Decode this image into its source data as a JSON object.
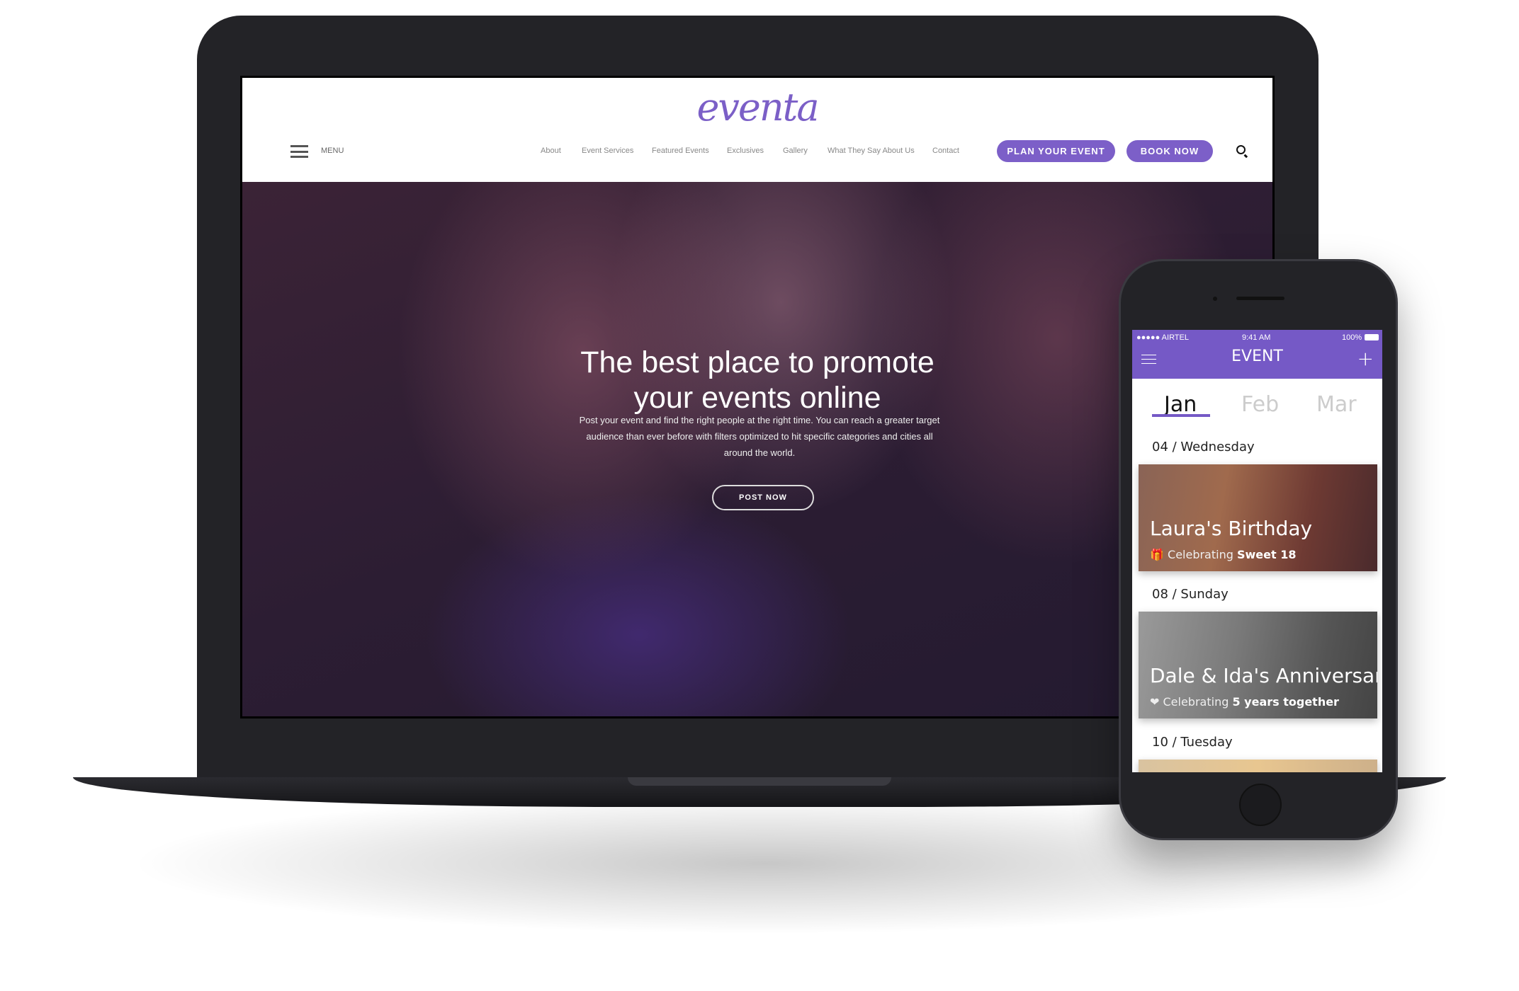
{
  "website": {
    "logo": "eventa",
    "menu_label": "MENU",
    "nav": [
      "About",
      "Event Services",
      "Featured Events",
      "Exclusives",
      "Gallery",
      "What They Say About Us",
      "Contact"
    ],
    "plan_button": "PLAN YOUR EVENT",
    "book_button": "BOOK NOW",
    "hero": {
      "title": "The best place to promote your events online",
      "text": "Post your event and find the right people at the right time. You can reach a greater target audience than ever before with filters optimized to hit specific categories and cities all around the world.",
      "button": "POST NOW"
    },
    "accent": "#7c5fc8"
  },
  "app": {
    "status": {
      "carrier": "●●●●● AIRTEL",
      "time": "9:41 AM",
      "battery": "100%"
    },
    "title": "EVENT",
    "tabs": [
      "Jan",
      "Feb",
      "Mar"
    ],
    "active_tab": "Jan",
    "events": [
      {
        "date": "04 / Wednesday",
        "title": "Laura's Birthday",
        "sub_prefix": "Celebrating",
        "sub_bold": "Sweet 18",
        "icon": "gift-icon"
      },
      {
        "date": "08 / Sunday",
        "title": "Dale & Ida's Anniversary",
        "sub_prefix": "Celebrating",
        "sub_bold": "5 years together",
        "icon": "hearts-icon"
      },
      {
        "date": "10 / Tuesday"
      }
    ],
    "accent": "#7559c6"
  }
}
